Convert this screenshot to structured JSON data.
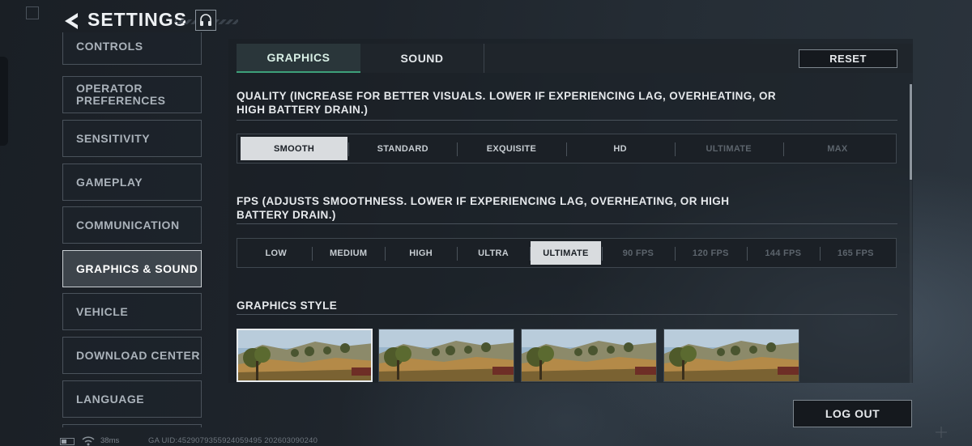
{
  "header": {
    "title": "SETTINGS"
  },
  "sidebar": {
    "items": [
      {
        "label": "CONTROLS"
      },
      {
        "label": "OPERATOR PREFERENCES"
      },
      {
        "label": "SENSITIVITY"
      },
      {
        "label": "GAMEPLAY"
      },
      {
        "label": "COMMUNICATION"
      },
      {
        "label": "GRAPHICS & SOUND"
      },
      {
        "label": "VEHICLE"
      },
      {
        "label": "DOWNLOAD CENTER"
      },
      {
        "label": "LANGUAGE"
      }
    ],
    "active": "GRAPHICS & SOUND"
  },
  "tabs": [
    {
      "label": "GRAPHICS"
    },
    {
      "label": "SOUND"
    }
  ],
  "active_tab": "GRAPHICS",
  "reset_label": "RESET",
  "quality": {
    "label": "QUALITY (INCREASE FOR BETTER VISUALS. LOWER IF EXPERIENCING LAG, OVERHEATING, OR HIGH BATTERY DRAIN.)",
    "options": [
      "SMOOTH",
      "STANDARD",
      "EXQUISITE",
      "HD",
      "ULTIMATE",
      "MAX"
    ],
    "selected": "SMOOTH",
    "disabled": [
      "ULTIMATE",
      "MAX"
    ]
  },
  "fps": {
    "label": "FPS (ADJUSTS SMOOTHNESS. LOWER IF EXPERIENCING LAG, OVERHEATING, OR HIGH BATTERY DRAIN.)",
    "options": [
      "LOW",
      "MEDIUM",
      "HIGH",
      "ULTRA",
      "ULTIMATE",
      "90 FPS",
      "120 FPS",
      "144 FPS",
      "165 FPS"
    ],
    "selected": "ULTIMATE",
    "disabled": [
      "90 FPS",
      "120 FPS",
      "144 FPS",
      "165 FPS"
    ]
  },
  "graphics_style": {
    "label": "GRAPHICS STYLE",
    "selected_index": 0
  },
  "logout_label": "LOG OUT",
  "status": {
    "ping": "38ms",
    "uid": "GA UID:4529079355924059495 202603090240"
  },
  "colors": {
    "accent": "#3da07a",
    "selected_segment": "#d9dcdf",
    "background": "#1e242b"
  }
}
